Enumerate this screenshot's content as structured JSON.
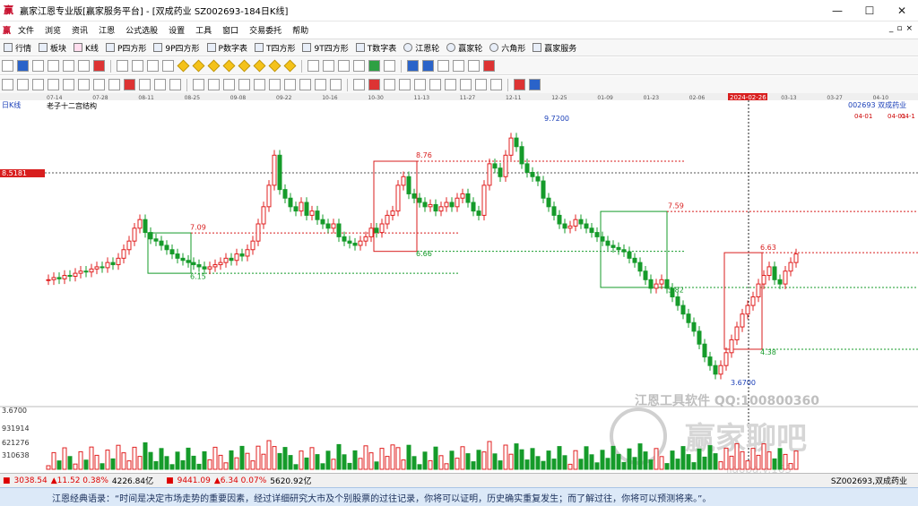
{
  "window": {
    "title": "赢家江恩专业版[赢家服务平台] - [双成药业  SZ002693-184日K线]",
    "controls": [
      "—",
      "☐",
      "✕"
    ]
  },
  "menu": [
    "文件",
    "浏览",
    "资讯",
    "江恩",
    "公式选股",
    "设置",
    "工具",
    "窗口",
    "交易委托",
    "帮助"
  ],
  "mdi_controls": [
    "_",
    "▫",
    "×"
  ],
  "toolbar_main": [
    {
      "label": "行情",
      "icon": "grid-icon"
    },
    {
      "label": "板块",
      "icon": "blocks-icon"
    },
    {
      "label": "K线",
      "icon": "candle-icon"
    },
    {
      "label": "P四方形",
      "icon": "p-square-icon"
    },
    {
      "label": "9P四方形",
      "icon": "9p-square-icon"
    },
    {
      "label": "P数字表",
      "icon": "p-table-icon"
    },
    {
      "label": "T四方形",
      "icon": "t-square-icon"
    },
    {
      "label": "9T四方形",
      "icon": "9t-square-icon"
    },
    {
      "label": "T数字表",
      "icon": "t-table-icon"
    },
    {
      "label": "江恩轮",
      "icon": "gann-wheel-icon"
    },
    {
      "label": "赢家轮",
      "icon": "winner-wheel-icon"
    },
    {
      "label": "六角形",
      "icon": "hexagon-icon"
    },
    {
      "label": "赢家服务",
      "icon": "service-icon"
    }
  ],
  "chart_header": {
    "period_label": "日K线",
    "indicator": "老子十二宫结构",
    "symbol_info": "002693  双成药业",
    "date_highlight": "2024-02-26",
    "right_dates": [
      "04-01",
      "04-01",
      "04-1"
    ]
  },
  "date_ticks": [
    "07-14",
    "07-28",
    "08-11",
    "08-25",
    "09-08",
    "09-22",
    "10-16",
    "10-30",
    "11-13",
    "11-27",
    "12-11",
    "12-25",
    "01-09",
    "01-23",
    "02-06",
    "02-26",
    "03-13",
    "03-27",
    "04-10"
  ],
  "price_marker": "8.5181",
  "chart_data": {
    "type": "candlestick",
    "title": "",
    "annotations": [
      {
        "label": "9.7200",
        "kind": "high"
      },
      {
        "label": "8.76",
        "kind": "box-top"
      },
      {
        "label": "7.59",
        "kind": "box-top"
      },
      {
        "label": "7.09",
        "kind": "box-top"
      },
      {
        "label": "6.66",
        "kind": "box-bottom"
      },
      {
        "label": "6.63",
        "kind": "box-top"
      },
      {
        "label": "6.15",
        "kind": "box-bottom"
      },
      {
        "label": "5.82",
        "kind": "box-bottom"
      },
      {
        "label": "4.38",
        "kind": "box-bottom"
      },
      {
        "label": "3.6700",
        "kind": "low"
      }
    ],
    "ylim": [
      3.67,
      9.72
    ],
    "volume_axis": [
      "3.6700",
      "931914",
      "621276",
      "310638"
    ],
    "colors": {
      "up": "#e02020",
      "down": "#159b2a"
    }
  },
  "watermark": {
    "line1": "江恩工具软件  QQ:100800360",
    "line2": "赢家聊吧",
    "line3": "liaoba.v.163"
  },
  "status": {
    "sh": "3038.54",
    "sh_change": "▲11.52 0.38%",
    "sh_amount": "4226.84亿",
    "sz": "9441.09",
    "sz_change": "▲6.34 0.07%",
    "sz_amount": "5620.92亿",
    "current": "SZ002693,双成药业"
  },
  "quote": "江恩经典语录：“时间是决定市场走势的重要因素，经过详细研究大市及个别股票的过往记录，你将可以证明，历史确实重复发生；而了解过往，你将可以预测将来。”。"
}
